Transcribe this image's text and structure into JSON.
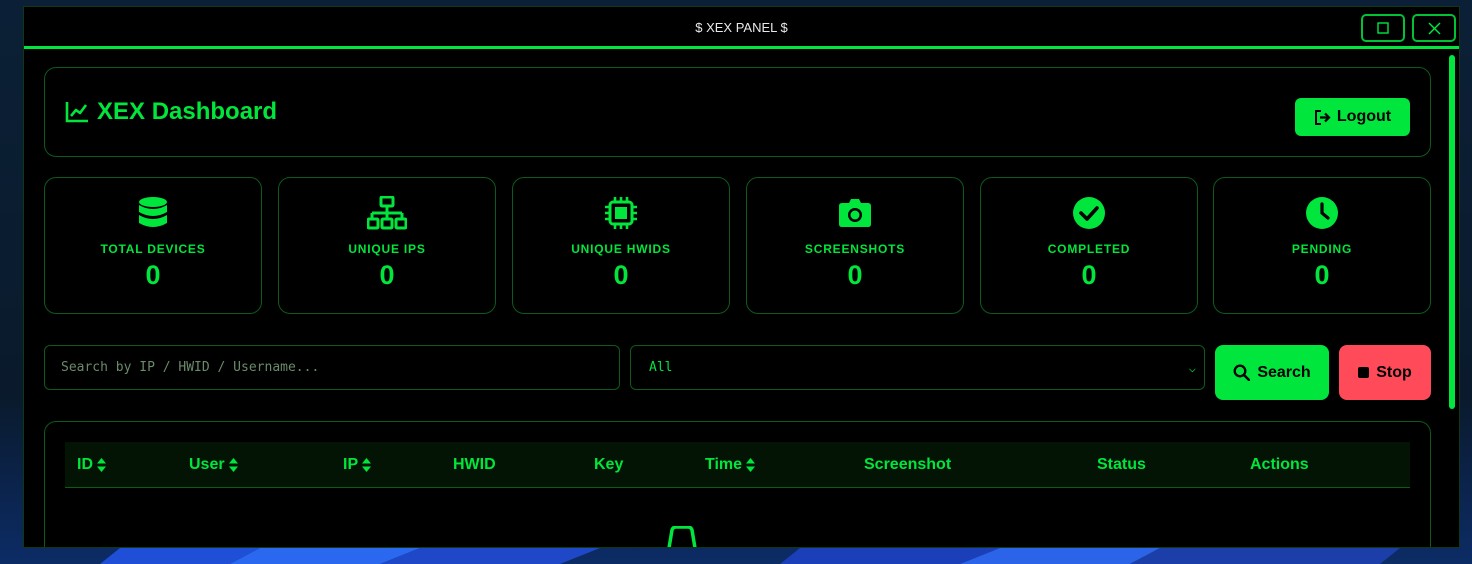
{
  "window": {
    "title": "$ XEX PANEL $"
  },
  "header": {
    "title": "XEX Dashboard",
    "logout_label": "Logout"
  },
  "stats": [
    {
      "label": "TOTAL DEVICES",
      "value": "0",
      "icon": "database-icon"
    },
    {
      "label": "UNIQUE IPS",
      "value": "0",
      "icon": "network-icon"
    },
    {
      "label": "UNIQUE HWIDS",
      "value": "0",
      "icon": "chip-icon"
    },
    {
      "label": "SCREENSHOTS",
      "value": "0",
      "icon": "camera-icon"
    },
    {
      "label": "COMPLETED",
      "value": "0",
      "icon": "check-circle-icon"
    },
    {
      "label": "PENDING",
      "value": "0",
      "icon": "clock-icon"
    }
  ],
  "search": {
    "placeholder": "Search by IP / HWID / Username...",
    "filter_selected": "All",
    "search_label": "Search",
    "stop_label": "Stop"
  },
  "table": {
    "columns": [
      "ID",
      "User",
      "IP",
      "HWID",
      "Key",
      "Time",
      "Screenshot",
      "Status",
      "Actions"
    ]
  },
  "colors": {
    "accent": "#00e63c",
    "danger": "#ff4a5a",
    "background": "#000000"
  }
}
